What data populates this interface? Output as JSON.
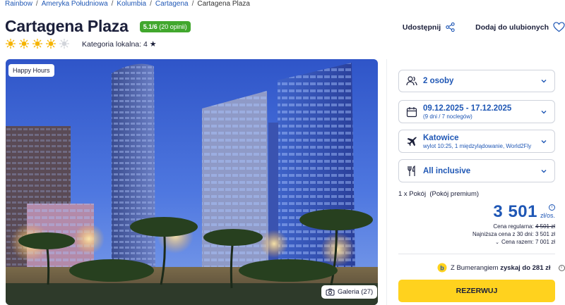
{
  "breadcrumb": {
    "items": [
      "Rainbow",
      "Ameryka Południowa",
      "Kolumbia",
      "Cartagena"
    ],
    "current": "Cartagena Plaza",
    "separator": "/"
  },
  "hotel": {
    "name": "Cartagena Plaza",
    "rating_value": "5.1/6",
    "rating_count": "(20 opinii)",
    "sun_rating": 4,
    "sun_max": 5,
    "category_label": "Kategoria lokalna: 4",
    "category_star": "★"
  },
  "actions": {
    "share_label": "Udostępnij",
    "favorite_label": "Dodaj do ulubionych"
  },
  "photo": {
    "badge": "Happy Hours",
    "gallery_label": "Galeria (27)"
  },
  "booking": {
    "guests": {
      "main": "2 osoby"
    },
    "dates": {
      "main": "09.12.2025 - 17.12.2025",
      "sub": "(9 dni / 7 noclegów)"
    },
    "flight": {
      "main": "Katowice",
      "sub": "wylot 10:25, 1 międzylądowanie, World2Fly"
    },
    "board": {
      "main": "All inclusive"
    },
    "room": "1 x Pokój  (Pokój premium)",
    "price": "3 501",
    "price_unit": "zł/os.",
    "regular_label": "Cena regularna:",
    "regular_value": "4 501 zł",
    "lowest_label": "Najniższa cena z 30 dni:",
    "lowest_value": "3 501 zł",
    "total_label": "Cena razem:",
    "total_value": "7 001 zł",
    "bumerang_prefix": "Z Bumerangiem",
    "bumerang_bold": "zyskaj do 281 zł",
    "reserve_label": "REZERWUJ"
  },
  "colors": {
    "accent_blue": "#1f57b5",
    "rating_green": "#41a72d",
    "cta_yellow": "#ffd21e",
    "sun_gold": "#f5b400"
  }
}
